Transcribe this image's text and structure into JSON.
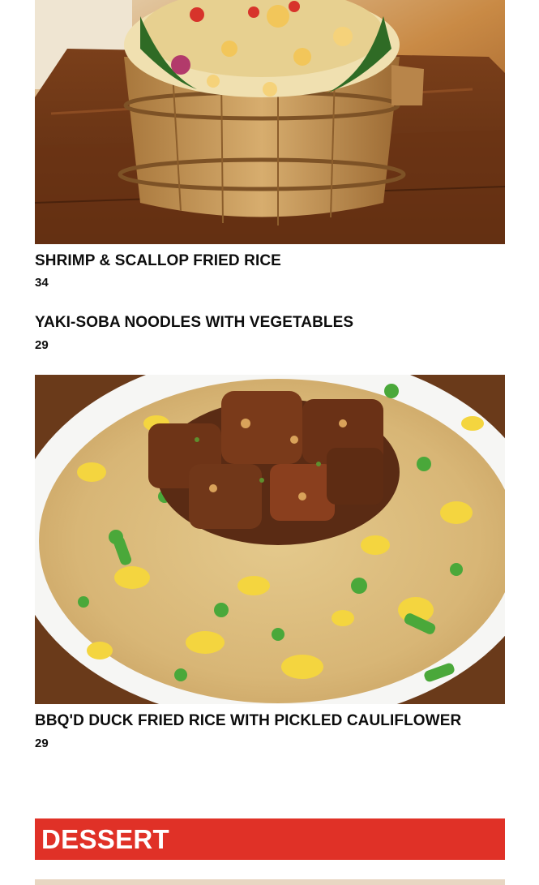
{
  "items": [
    {
      "name": "SHRIMP & SCALLOP FRIED RICE",
      "price": "34",
      "image": "shrimp-scallop-fried-rice-photo"
    },
    {
      "name": "YAKI-SOBA NOODLES WITH VEGETABLES",
      "price": "29"
    },
    {
      "name": "BBQ'D DUCK FRIED RICE WITH PICKLED CAULIFLOWER",
      "price": "29",
      "image": "bbq-duck-fried-rice-photo"
    }
  ],
  "section": {
    "title": "DESSERT"
  },
  "colors": {
    "section_band": "#e03127",
    "text": "#0d0d0d",
    "background": "#ffffff"
  }
}
